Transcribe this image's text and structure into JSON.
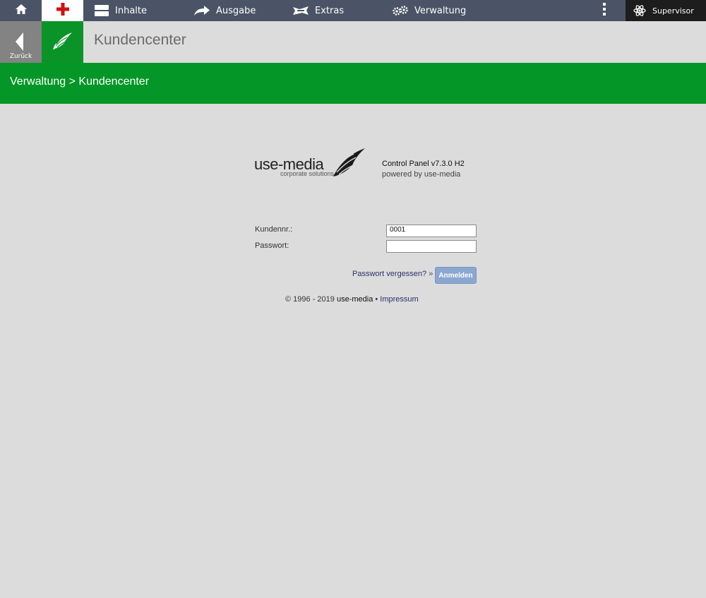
{
  "topbar": {
    "nav": [
      {
        "label": "Inhalte",
        "icon": "layout-icon"
      },
      {
        "label": "Ausgabe",
        "icon": "share-arrow-icon"
      },
      {
        "label": "Extras",
        "icon": "ribbon-icon"
      },
      {
        "label": "Verwaltung",
        "icon": "gears-icon"
      }
    ],
    "user": "Supervisor",
    "icons": {
      "home": "home-icon",
      "plus": "plus-icon",
      "more": "more-vertical-icon",
      "user": "atom-icon"
    },
    "colors": {
      "bar": "#4b5466",
      "plus": "#d01010",
      "user_bg": "#1d1d1d"
    }
  },
  "secondbar": {
    "back_label": "Zurück",
    "title": "Kundencenter"
  },
  "breadcrumb": {
    "text": "Verwaltung > Kundencenter",
    "color": "#049626"
  },
  "brand": {
    "logo_word": "use-media",
    "logo_tagline": "corporate solutions",
    "version": "Control Panel v7.3.0 H2",
    "powered": "powered by use-media"
  },
  "form": {
    "kunde_label": "Kundennr.:",
    "kunde_value": "0001",
    "pass_label": "Passwort:",
    "pass_value": "",
    "forgot": "Passwort vergessen?",
    "forgot_suffix": "»",
    "submit": "Anmelden"
  },
  "footer": {
    "copyright": "© 1996 - 2019",
    "brand": "use-media",
    "sep": "•",
    "impressum": "Impressum"
  }
}
